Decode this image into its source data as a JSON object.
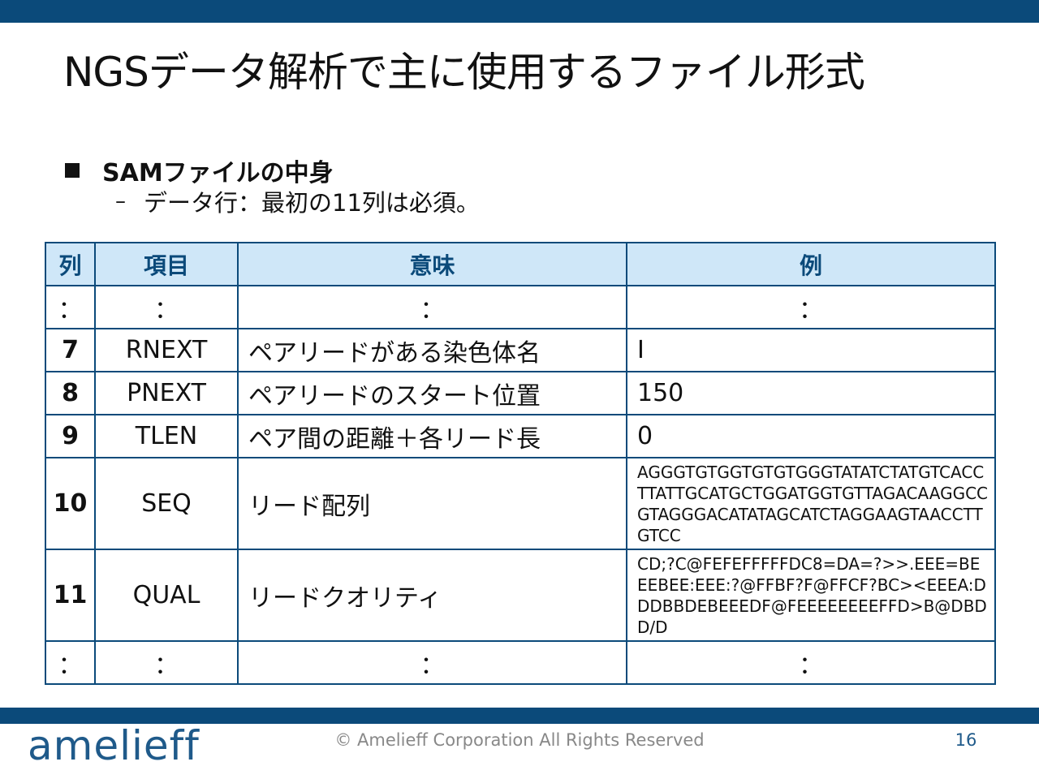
{
  "slide": {
    "title": "NGSデータ解析で主に使用するファイル形式",
    "bullet": "SAMファイルの中身",
    "sub_dash": "–",
    "sub_bullet": "データ行：最初の11列は必須。"
  },
  "table": {
    "headers": [
      "列",
      "項目",
      "意味",
      "例"
    ],
    "ellipsis": "：",
    "rows": [
      {
        "col": "7",
        "item": "RNEXT",
        "meaning": "ペアリードがある染色体名",
        "example": "I"
      },
      {
        "col": "8",
        "item": "PNEXT",
        "meaning": "ペアリードのスタート位置",
        "example": "150"
      },
      {
        "col": "9",
        "item": "TLEN",
        "meaning": "ペア間の距離＋各リード長",
        "example": "0"
      },
      {
        "col": "10",
        "item": "SEQ",
        "meaning": "リード配列",
        "example": "AGGGTGTGGTGTGTGGGTATATCTATGTCACCTTATTGCATGCTGGATGGTGTTAGACAAGGCCGTAGGGACATATAGCATCTAGGAAGTAACCTTGTCC"
      },
      {
        "col": "11",
        "item": "QUAL",
        "meaning": "リードクオリティ",
        "example": "CD;?C@FEFEFFFFFDC8=DA=?>>.EEE=BEEEBEE:EEE:?@FFBF?F@FFCF?BC><EEEA:DDDBBDEBEEEDF@FEEEEEEEEFFD>B@DBDD/D"
      }
    ]
  },
  "footer": {
    "logo": "amelieff",
    "copyright": "© Amelieff Corporation All Rights Reserved",
    "page_number": "16"
  },
  "colors": {
    "accent": "#0b4a7a",
    "header_fill": "#cfe7f8",
    "logo": "#1f5a8a"
  }
}
